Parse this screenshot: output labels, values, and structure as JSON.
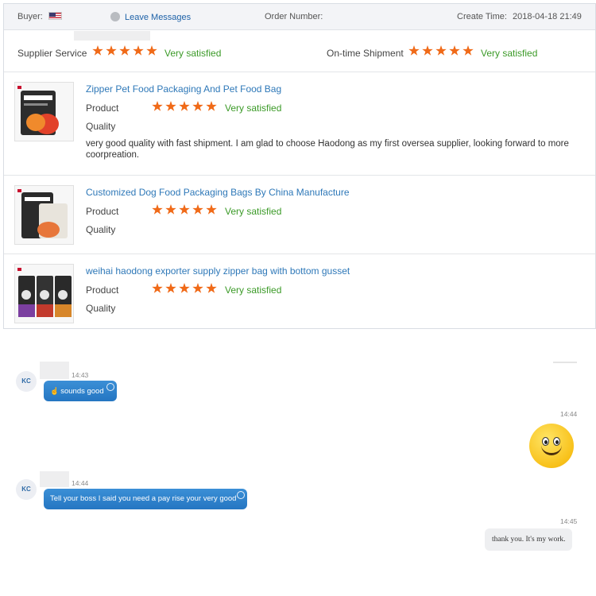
{
  "order_header": {
    "buyer_label": "Buyer:",
    "buyer_country_icon": "us-flag-icon",
    "leave_messages": "Leave Messages",
    "order_number_label": "Order Number:",
    "create_time_label": "Create Time:",
    "create_time_value": "2018-04-18 21:49"
  },
  "overall_ratings": {
    "supplier_service": {
      "label": "Supplier Service",
      "stars": 5,
      "verdict": "Very satisfied"
    },
    "ontime_shipment": {
      "label": "On-time Shipment",
      "stars": 5,
      "verdict": "Very satisfied"
    }
  },
  "products": [
    {
      "title": "Zipper Pet Food Packaging And Pet Food Bag",
      "product_label": "Product",
      "product_stars": 5,
      "product_verdict": "Very satisfied",
      "quality_label": "Quality",
      "comment": "very good quality with fast shipment. I am glad to choose Haodong as my first oversea supplier, looking forward to more coorpreation."
    },
    {
      "title": "Customized Dog Food Packaging Bags By China Manufacture",
      "product_label": "Product",
      "product_stars": 5,
      "product_verdict": "Very satisfied",
      "quality_label": "Quality"
    },
    {
      "title": "weihai haodong exporter supply zipper bag with bottom gusset",
      "product_label": "Product",
      "product_stars": 5,
      "product_verdict": "Very satisfied",
      "quality_label": "Quality"
    }
  ],
  "chat": {
    "messages": [
      {
        "sender": "KC",
        "time": "14:43",
        "text": "sounds good",
        "icon": "thumbs-up-icon"
      },
      {
        "sender": "me",
        "time": "14:44",
        "sticker": "smiley-face-icon"
      },
      {
        "sender": "KC",
        "time": "14:44",
        "text": "Tell your boss I said you need a pay rise your very good"
      },
      {
        "sender": "me",
        "time": "14:45",
        "text": "thank you. It's my work."
      }
    ]
  },
  "colors": {
    "star": "#f06a18",
    "satisfied": "#3b9a27",
    "link": "#2e78b8",
    "bubble": "#2576c2"
  }
}
